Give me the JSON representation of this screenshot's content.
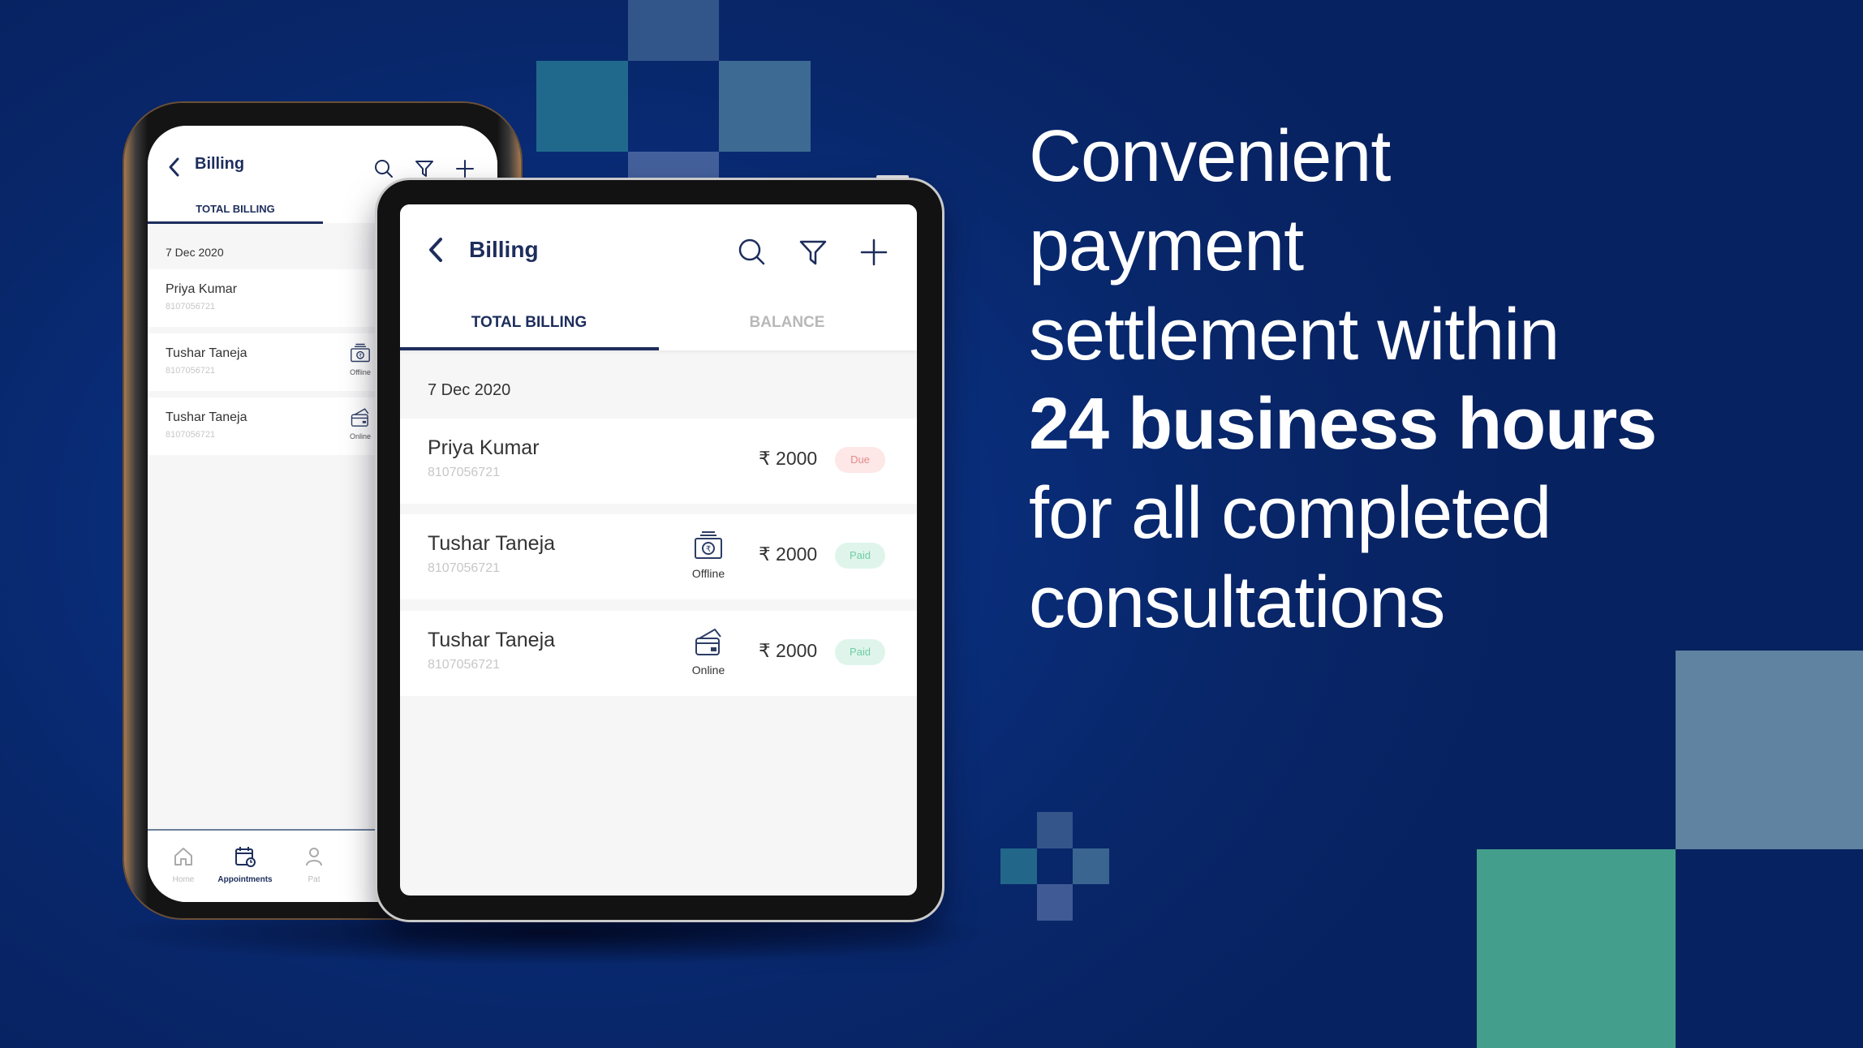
{
  "headline": {
    "lines": [
      "Convenient",
      "payment",
      "settlement within",
      "24 business hours",
      "for all completed",
      "consultations"
    ],
    "bold_line_index": 3
  },
  "colors": {
    "background": "#08256a",
    "primary_text": "#1d2d5c",
    "due_badge_bg": "#fde7e7",
    "due_badge_text": "#e38c8c",
    "paid_badge_bg": "#dff5ec",
    "paid_badge_text": "#72cca4",
    "accent_teal": "#439f8c",
    "accent_grey_blue": "#5f83a0"
  },
  "phone": {
    "header": {
      "title": "Billing",
      "back_icon": "chevron-left-icon",
      "actions": [
        "search-icon",
        "filter-icon",
        "plus-icon"
      ]
    },
    "tabs": [
      {
        "label": "TOTAL BILLING",
        "active": true
      }
    ],
    "date_header": "7 Dec 2020",
    "rows": [
      {
        "name": "Priya Kumar",
        "phone": "8107056721",
        "mode": ""
      },
      {
        "name": "Tushar Taneja",
        "phone": "8107056721",
        "mode": "Offline"
      },
      {
        "name": "Tushar Taneja",
        "phone": "8107056721",
        "mode": "Online"
      }
    ],
    "bottom_nav": [
      {
        "label": "Home",
        "icon": "home-icon",
        "active": false
      },
      {
        "label": "Appointments",
        "icon": "calendar-clock-icon",
        "active": true
      },
      {
        "label": "Pat",
        "icon": "patients-icon",
        "active": false
      }
    ]
  },
  "tablet": {
    "header": {
      "title": "Billing",
      "back_icon": "chevron-left-icon",
      "actions": [
        "search-icon",
        "filter-icon",
        "plus-icon"
      ]
    },
    "tabs": [
      {
        "label": "TOTAL BILLING",
        "active": true
      },
      {
        "label": "BALANCE",
        "active": false
      }
    ],
    "date_header": "7 Dec 2020",
    "rows": [
      {
        "name": "Priya Kumar",
        "phone": "8107056721",
        "mode": "",
        "amount": "₹ 2000",
        "status": "Due"
      },
      {
        "name": "Tushar Taneja",
        "phone": "8107056721",
        "mode": "Offline",
        "amount": "₹ 2000",
        "status": "Paid"
      },
      {
        "name": "Tushar Taneja",
        "phone": "8107056721",
        "mode": "Online",
        "amount": "₹ 2000",
        "status": "Paid"
      }
    ]
  }
}
